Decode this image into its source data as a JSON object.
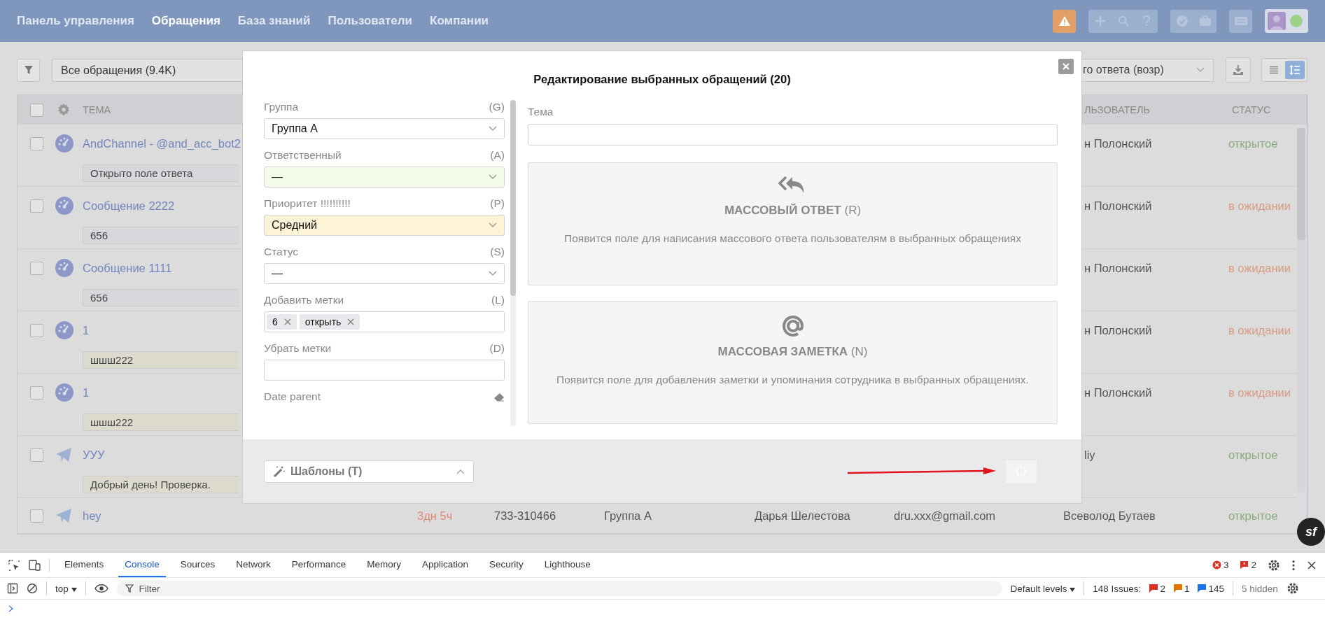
{
  "nav": {
    "items": [
      {
        "label": "Панель управления",
        "selected": false
      },
      {
        "label": "Обращения",
        "selected": true
      },
      {
        "label": "База знаний",
        "selected": false
      },
      {
        "label": "Пользователи",
        "selected": false
      },
      {
        "label": "Компании",
        "selected": false
      }
    ],
    "user": {
      "online": true
    }
  },
  "toolbar": {
    "view_filter": "Все обращения (9.4K)",
    "sort": "го ответа (возр)",
    "view_modes": [
      {
        "kind": "list",
        "selected": false
      },
      {
        "kind": "expanded",
        "selected": true
      }
    ]
  },
  "table": {
    "header_checked": false,
    "columns": [
      "ТЕМА",
      "ЛЬЗОВАТЕЛЬ",
      "СТАТУС"
    ],
    "rows": [
      {
        "checked": false,
        "channel": {
          "kind": "widget"
        },
        "subject": "AndChannel - @and_acc_bot2",
        "note": {
          "kind": "plain",
          "text": "Открыто поле ответа"
        },
        "user": "н Полонский",
        "status": {
          "kind": "open",
          "text": "открытое"
        }
      },
      {
        "checked": false,
        "channel": {
          "kind": "widget"
        },
        "subject": "Сообщение 2222",
        "note": {
          "kind": "plain",
          "text": "656"
        },
        "user": "н Полонский",
        "status": {
          "kind": "pending",
          "text": "в ожидании"
        }
      },
      {
        "checked": false,
        "channel": {
          "kind": "widget"
        },
        "subject": "Сообщение 1111",
        "note": {
          "kind": "plain",
          "text": "656"
        },
        "user": "н Полонский",
        "status": {
          "kind": "pending",
          "text": "в ожидании"
        }
      },
      {
        "checked": false,
        "channel": {
          "kind": "widget"
        },
        "subject": "1",
        "note": {
          "kind": "highlighted",
          "text": "шшш222"
        },
        "user": "н Полонский",
        "status": {
          "kind": "pending",
          "text": "в ожидании"
        }
      },
      {
        "checked": false,
        "channel": {
          "kind": "widget"
        },
        "subject": "1",
        "note": {
          "kind": "highlighted",
          "text": "шшш222"
        },
        "user": "н Полонский",
        "status": {
          "kind": "pending",
          "text": "в ожидании"
        }
      },
      {
        "checked": false,
        "channel": {
          "kind": "telegram"
        },
        "subject": "УУУ",
        "note": {
          "kind": "highlighted",
          "text": "Добрый день! Проверка."
        },
        "user": "liy",
        "status": {
          "kind": "open",
          "text": "открытое"
        }
      },
      {
        "checked": false,
        "channel": {
          "kind": "telegram"
        },
        "subject": "hey",
        "time": "3дн 5ч",
        "phone": "733-310466",
        "group": "Группа А",
        "client": "Дарья Шелестова",
        "email": "dru.xxx@gmail.com",
        "user": "Всеволод Бутаев",
        "status": {
          "kind": "open",
          "text": "открытое"
        }
      }
    ]
  },
  "modal": {
    "title": "Редактирование выбранных обращений (20)",
    "fields": [
      {
        "kind": "select",
        "label": "Группа",
        "shortcut": "(G)",
        "value": "Группа А",
        "color": "#ffffff"
      },
      {
        "kind": "select",
        "label": "Ответственный",
        "shortcut": "(A)",
        "value": "—",
        "color": "#f2fce9"
      },
      {
        "kind": "select",
        "label": "Приоритет !!!!!!!!!!",
        "shortcut": "(P)",
        "value": "Средний",
        "color": "#fdf3d6"
      },
      {
        "kind": "select",
        "label": "Статус",
        "shortcut": "(S)",
        "value": "—",
        "color": "#ffffff"
      },
      {
        "kind": "tags",
        "label": "Добавить метки",
        "shortcut": "(L)",
        "tags": [
          "6",
          "открыть"
        ]
      },
      {
        "kind": "input",
        "label": "Убрать метки",
        "shortcut": "(D)"
      },
      {
        "kind": "date",
        "label": "Date parent"
      }
    ],
    "subject": {
      "label": "Тема"
    },
    "actions": [
      {
        "kind": "reply",
        "title": "МАССОВЫЙ ОТВЕТ",
        "shortcut": "(R)",
        "description": "Появится поле для написания массового ответа пользователям в выбранных обращениях"
      },
      {
        "kind": "note",
        "title": "МАССОВАЯ ЗАМЕТКА",
        "shortcut": "(N)",
        "description": "Появится поле для добавления заметки и упоминания сотрудника в выбранных обращениях."
      }
    ],
    "templates": {
      "label": "Шаблоны (T)"
    },
    "submit": {
      "loading": true
    },
    "annotation": {
      "kind": "arrow"
    }
  },
  "debug_badge": "sf",
  "devtools": {
    "tabs": [
      {
        "label": "Elements",
        "selected": false
      },
      {
        "label": "Console",
        "selected": true
      },
      {
        "label": "Sources",
        "selected": false
      },
      {
        "label": "Network",
        "selected": false
      },
      {
        "label": "Performance",
        "selected": false
      },
      {
        "label": "Memory",
        "selected": false
      },
      {
        "label": "Application",
        "selected": false
      },
      {
        "label": "Security",
        "selected": false
      },
      {
        "label": "Lighthouse",
        "selected": false
      }
    ],
    "errors": "3",
    "warnings": "2",
    "context": "top",
    "filter_placeholder": "Filter",
    "levels": "Default levels",
    "issues_label": "148 Issues:",
    "issues": [
      {
        "kind": "error",
        "count": "2"
      },
      {
        "kind": "warning",
        "count": "1"
      },
      {
        "kind": "info",
        "count": "145"
      }
    ],
    "hidden": "5 hidden"
  }
}
